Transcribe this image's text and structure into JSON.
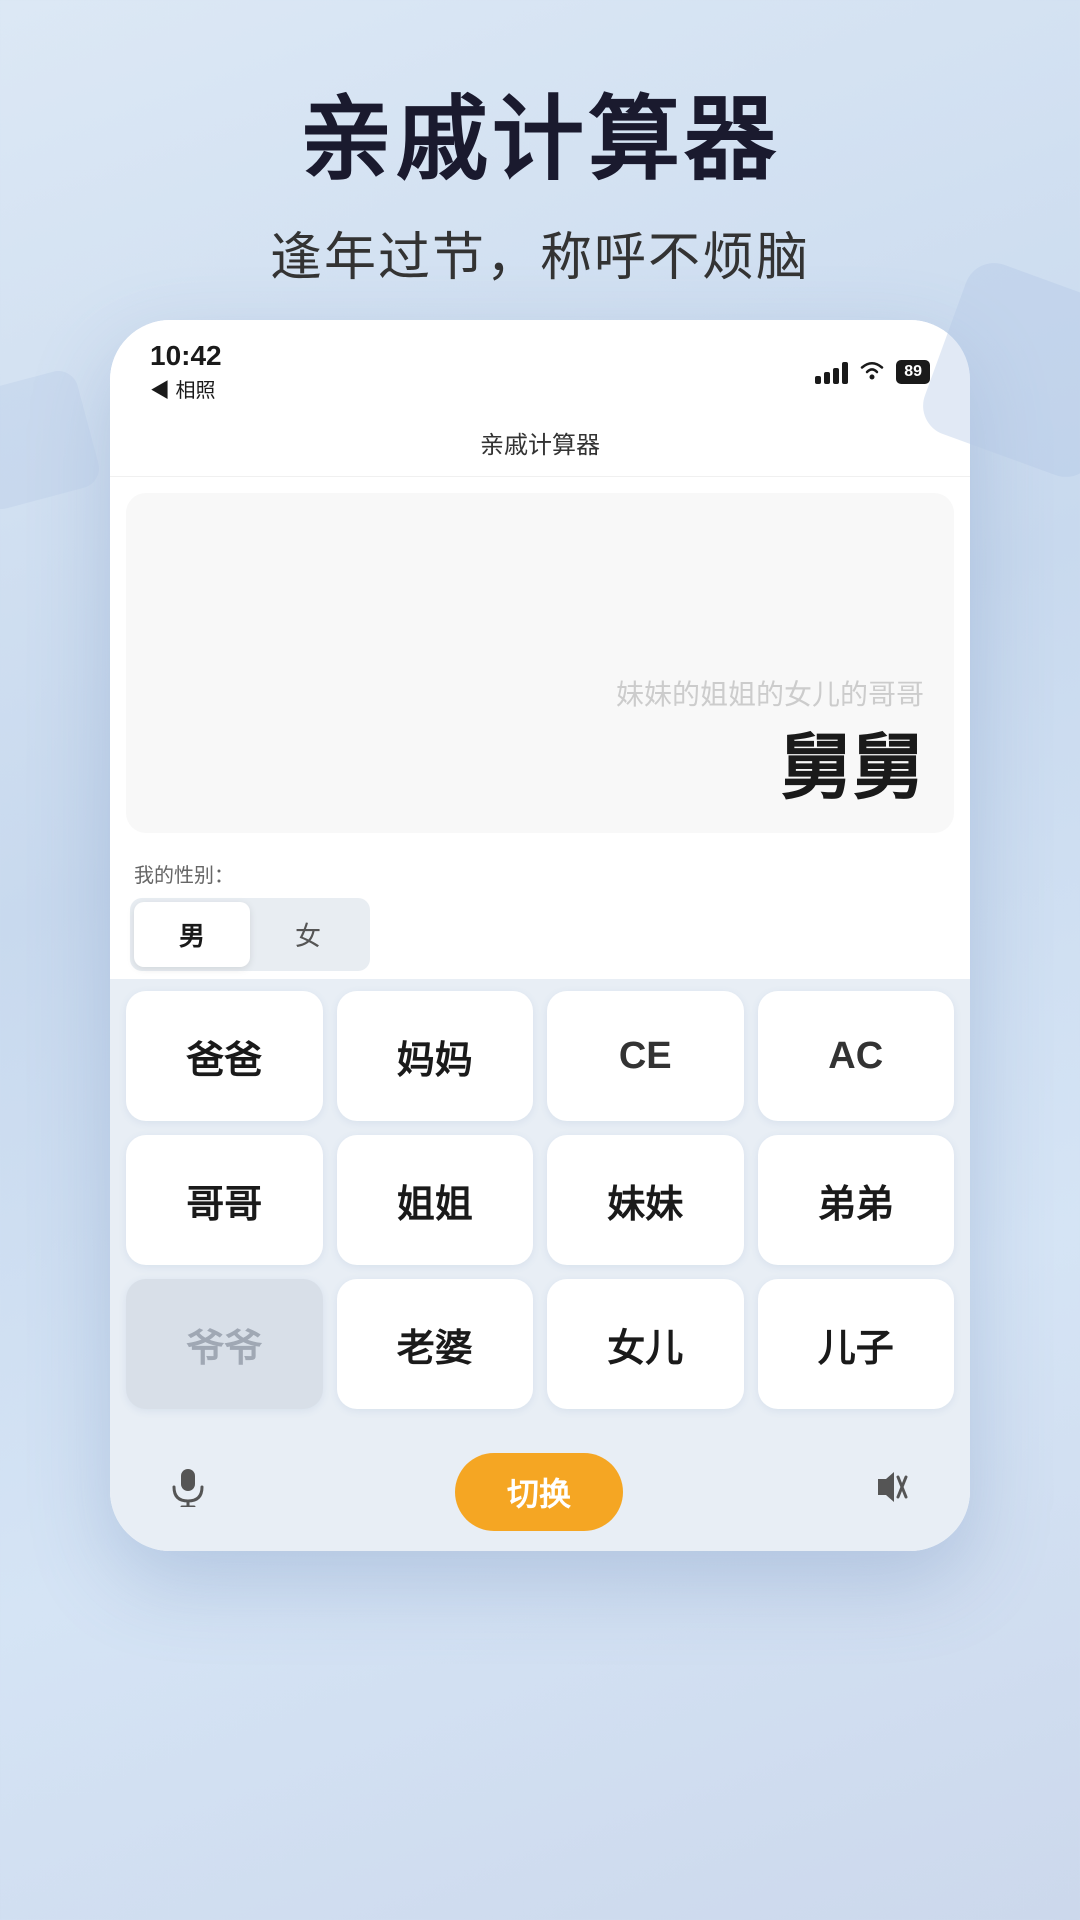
{
  "app": {
    "title": "亲戚计算器",
    "subtitle": "逢年过节，称呼不烦脑",
    "nav_title": "亲戚计算器"
  },
  "status_bar": {
    "time": "10:42",
    "back_label": "◀ 相照",
    "battery": "89"
  },
  "result_area": {
    "placeholder": "妹妹的姐姐的女儿的哥哥",
    "answer": "舅舅"
  },
  "gender": {
    "label": "我的性别：",
    "options": [
      "男",
      "女"
    ],
    "active": "男"
  },
  "keypad": {
    "rows": [
      [
        {
          "label": "爸爸",
          "type": "normal"
        },
        {
          "label": "妈妈",
          "type": "normal"
        },
        {
          "label": "CE",
          "type": "normal"
        },
        {
          "label": "AC",
          "type": "normal"
        }
      ],
      [
        {
          "label": "哥哥",
          "type": "normal"
        },
        {
          "label": "姐姐",
          "type": "normal"
        },
        {
          "label": "妹妹",
          "type": "normal"
        },
        {
          "label": "弟弟",
          "type": "normal"
        }
      ],
      [
        {
          "label": "爷爷",
          "type": "disabled"
        },
        {
          "label": "老婆",
          "type": "normal"
        },
        {
          "label": "女儿",
          "type": "normal"
        },
        {
          "label": "儿子",
          "type": "normal"
        }
      ]
    ]
  },
  "bottom_bar": {
    "mic_icon": "🎤",
    "sound_icon": "🔇",
    "switch_label": "切换"
  }
}
